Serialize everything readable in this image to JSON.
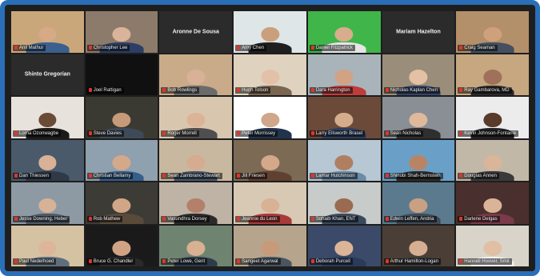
{
  "window": {
    "accent": "#2a6fb8",
    "background": "#1e1e1e",
    "active_speaker_color": "#b8d84a"
  },
  "participants": [
    {
      "name": "Anil Mathur",
      "bg": "#caa77b",
      "skin": "#d6a987",
      "shirt": "#3b5f8e",
      "video": true
    },
    {
      "name": "Christopher Lee",
      "bg": "#8c7a6a",
      "skin": "#d9b49a",
      "shirt": "#2c3e66",
      "video": true
    },
    {
      "name": "",
      "center": "Aronne De Sousa",
      "video": false
    },
    {
      "name": "Amy Chen",
      "bg": "#dfe6e8",
      "skin": "#caa07c",
      "shirt": "#1f1f1f",
      "video": true
    },
    {
      "name": "Daniel Fitzpatrick",
      "bg": "#3fb54a",
      "skin": "#d7ad8d",
      "shirt": "#e6e6e6",
      "video": true
    },
    {
      "name": "",
      "center": "Mariam Hazelton",
      "video": false
    },
    {
      "name": "Craig Seaman",
      "bg": "#b38f6a",
      "skin": "#cfa07c",
      "shirt": "#44505f",
      "video": true
    },
    {
      "name": "",
      "center": "Shinto Gregorian",
      "video": false
    },
    {
      "name": "Joel Rattigan",
      "bg": "#101010",
      "video": false
    },
    {
      "name": "Bob Rowlings",
      "bg": "#c9ab8a",
      "skin": "#d8b196",
      "shirt": "#6b6b6b",
      "video": true
    },
    {
      "name": "Hugh Tolson",
      "bg": "#dfd2bf",
      "skin": "#e3c1a8",
      "shirt": "#7a6550",
      "video": true
    },
    {
      "name": "Dara Harrington",
      "bg": "#a8b4b9",
      "skin": "#d2a285",
      "shirt": "#c13b3b",
      "video": true
    },
    {
      "name": "Nicholas Kaplan Chen",
      "bg": "#9a8d7a",
      "skin": "#e4c0a4",
      "shirt": "#334466",
      "video": true,
      "active": true
    },
    {
      "name": "Ray Gambarova, MD",
      "bg": "#c6a77f",
      "skin": "#a0715a",
      "shirt": "#2a2a2a",
      "video": true
    },
    {
      "name": "Lorna Ozonwagbe",
      "bg": "#e7e2dc",
      "skin": "#6b4a36",
      "shirt": "#1a1a1a",
      "video": true
    },
    {
      "name": "Steve Davies",
      "bg": "#3b3a32",
      "skin": "#c79a7a",
      "shirt": "#3e4a58",
      "video": true
    },
    {
      "name": "Roger Morrell",
      "bg": "#d8c7ae",
      "skin": "#dbb497",
      "shirt": "#4f4f4f",
      "video": true
    },
    {
      "name": "Peter Morrissey",
      "bg": "#ffffff",
      "skin": "#d0a78a",
      "shirt": "#22334d",
      "video": true
    },
    {
      "name": "Larry Ellsworth Brasel",
      "bg": "#6b4a3a",
      "skin": "#d6ad8c",
      "shirt": "#2b3e5e",
      "video": true
    },
    {
      "name": "Sean Nicholas",
      "bg": "#8a8f95",
      "skin": "#e0b99b",
      "shirt": "#2f2f2f",
      "video": true
    },
    {
      "name": "Kevin Johnson-Fontaine",
      "bg": "#ececec",
      "skin": "#5a3a2b",
      "shirt": "#222222",
      "video": true
    },
    {
      "name": "Dan Thiessen",
      "bg": "#4a5a6a",
      "skin": "#d8b197",
      "shirt": "#2f3a48",
      "video": true
    },
    {
      "name": "Christian Bellamy",
      "bg": "#8fa0ae",
      "skin": "#d4a98a",
      "shirt": "#355e8c",
      "video": true
    },
    {
      "name": "Sean Zambrano-Stewart",
      "bg": "#c9b8a0",
      "skin": "#d5ac90",
      "shirt": "#46566a",
      "video": true
    },
    {
      "name": "Jill Friesen",
      "bg": "#7c6a55",
      "skin": "#d4a88a",
      "shirt": "#604030",
      "video": true
    },
    {
      "name": "Lamar Hutchinson",
      "bg": "#b7c7d4",
      "skin": "#b07f62",
      "shirt": "#6a8ca8",
      "video": true
    },
    {
      "name": "Shinobi Shah-Bernstein",
      "bg": "#6aa0c8",
      "skin": "#b98466",
      "shirt": "#2b2b2b",
      "video": true
    },
    {
      "name": "Douglas Annen",
      "bg": "#c2b8a8",
      "skin": "#dbb59a",
      "shirt": "#3a3a3a",
      "video": true
    },
    {
      "name": "Jesse Downing, Heber",
      "bg": "#8d9aa3",
      "skin": "#d8b296",
      "shirt": "#505a66",
      "video": true
    },
    {
      "name": "Rob Mathew",
      "bg": "#3c3b36",
      "skin": "#d0a687",
      "shirt": "#5a4a3a",
      "video": true
    },
    {
      "name": "Vasundhra Dorsey",
      "bg": "#bfb3a5",
      "skin": "#b4806a",
      "shirt": "#2a2a2a",
      "video": true
    },
    {
      "name": "Jeannie du Leon",
      "bg": "#d8c9b5",
      "skin": "#d9b195",
      "shirt": "#a83a3a",
      "video": true
    },
    {
      "name": "Sohaib Khan, ENT",
      "bg": "#c7cbc9",
      "skin": "#9a6b52",
      "shirt": "#3a4a5e",
      "video": true
    },
    {
      "name": "Edwin Leffen, Andria",
      "bg": "#5c7a8e",
      "skin": "#caa083",
      "shirt": "#3f4a56",
      "video": true
    },
    {
      "name": "Darlene Delgas",
      "bg": "#4a2f2f",
      "skin": "#dab497",
      "shirt": "#7a3a4a",
      "video": true
    },
    {
      "name": "Paul Nederhoed",
      "bg": "#d4c2a2",
      "skin": "#ddb59a",
      "shirt": "#5f6e7d",
      "video": true
    },
    {
      "name": "Bruce G. Chandler",
      "bg": "#1a1a1a",
      "skin": "#cfa384",
      "shirt": "#2a2a2a",
      "video": true
    },
    {
      "name": "Peter Lowe, Gent",
      "bg": "#6f8470",
      "skin": "#d8b092",
      "shirt": "#2d3b4a",
      "video": true
    },
    {
      "name": "Sangeet Agarwal",
      "bg": "#b6a58c",
      "skin": "#c79a7a",
      "shirt": "#4a5560",
      "video": true
    },
    {
      "name": "Deborah Purcell",
      "bg": "#3a4a68",
      "skin": "#dcb498",
      "shirt": "#2a3a5a",
      "video": true
    },
    {
      "name": "Arthur Hamilton-Logan",
      "bg": "#4a3e36",
      "skin": "#d6ae92",
      "shirt": "#3a3a3a",
      "video": true
    },
    {
      "name": "Hanneli Hoover, Smit",
      "bg": "#d9d4c9",
      "skin": "#e0bfa5",
      "shirt": "#f2f2f2",
      "video": true
    }
  ]
}
